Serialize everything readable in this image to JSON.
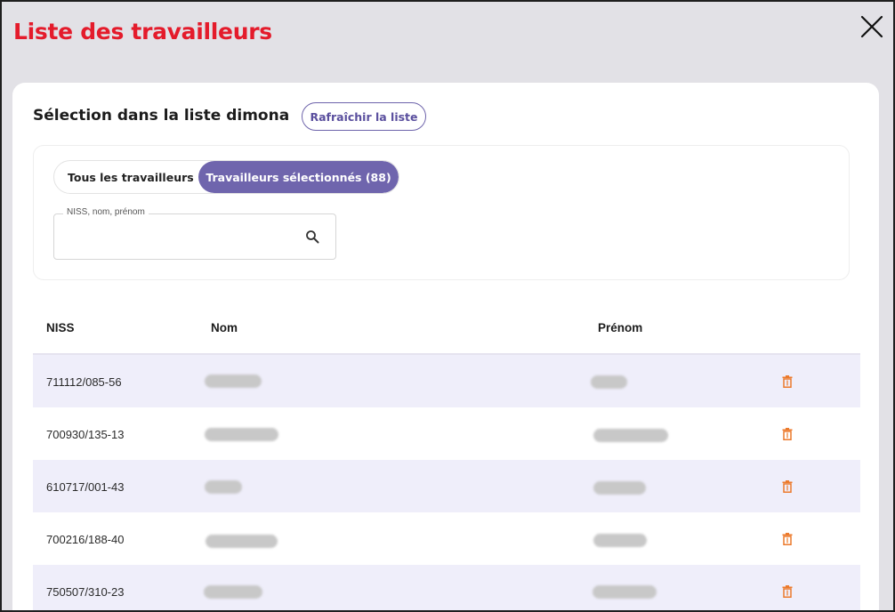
{
  "modal": {
    "title": "Liste des travailleurs"
  },
  "selection": {
    "title": "Sélection dans la liste dimona",
    "refresh_label": "Rafraîchir la liste"
  },
  "tabs": [
    {
      "label": "Tous les travailleurs",
      "active": false
    },
    {
      "label": "Travailleurs sélectionnés (88)",
      "active": true
    }
  ],
  "search": {
    "label": "NISS, nom, prénom",
    "value": ""
  },
  "table": {
    "headers": {
      "niss": "NISS",
      "nom": "Nom",
      "prenom": "Prénom"
    },
    "rows": [
      {
        "niss": "711112/085-56"
      },
      {
        "niss": "700930/135-13"
      },
      {
        "niss": "610717/001-43"
      },
      {
        "niss": "700216/188-40"
      },
      {
        "niss": "750507/310-23"
      }
    ]
  },
  "colors": {
    "title": "#e41b2b",
    "accent": "#6f65ad",
    "row_shade": "#efeefa",
    "delete_icon": "#ec7a2c"
  },
  "icons": {
    "close": "close-icon",
    "search": "search-icon",
    "delete": "trash-icon"
  }
}
